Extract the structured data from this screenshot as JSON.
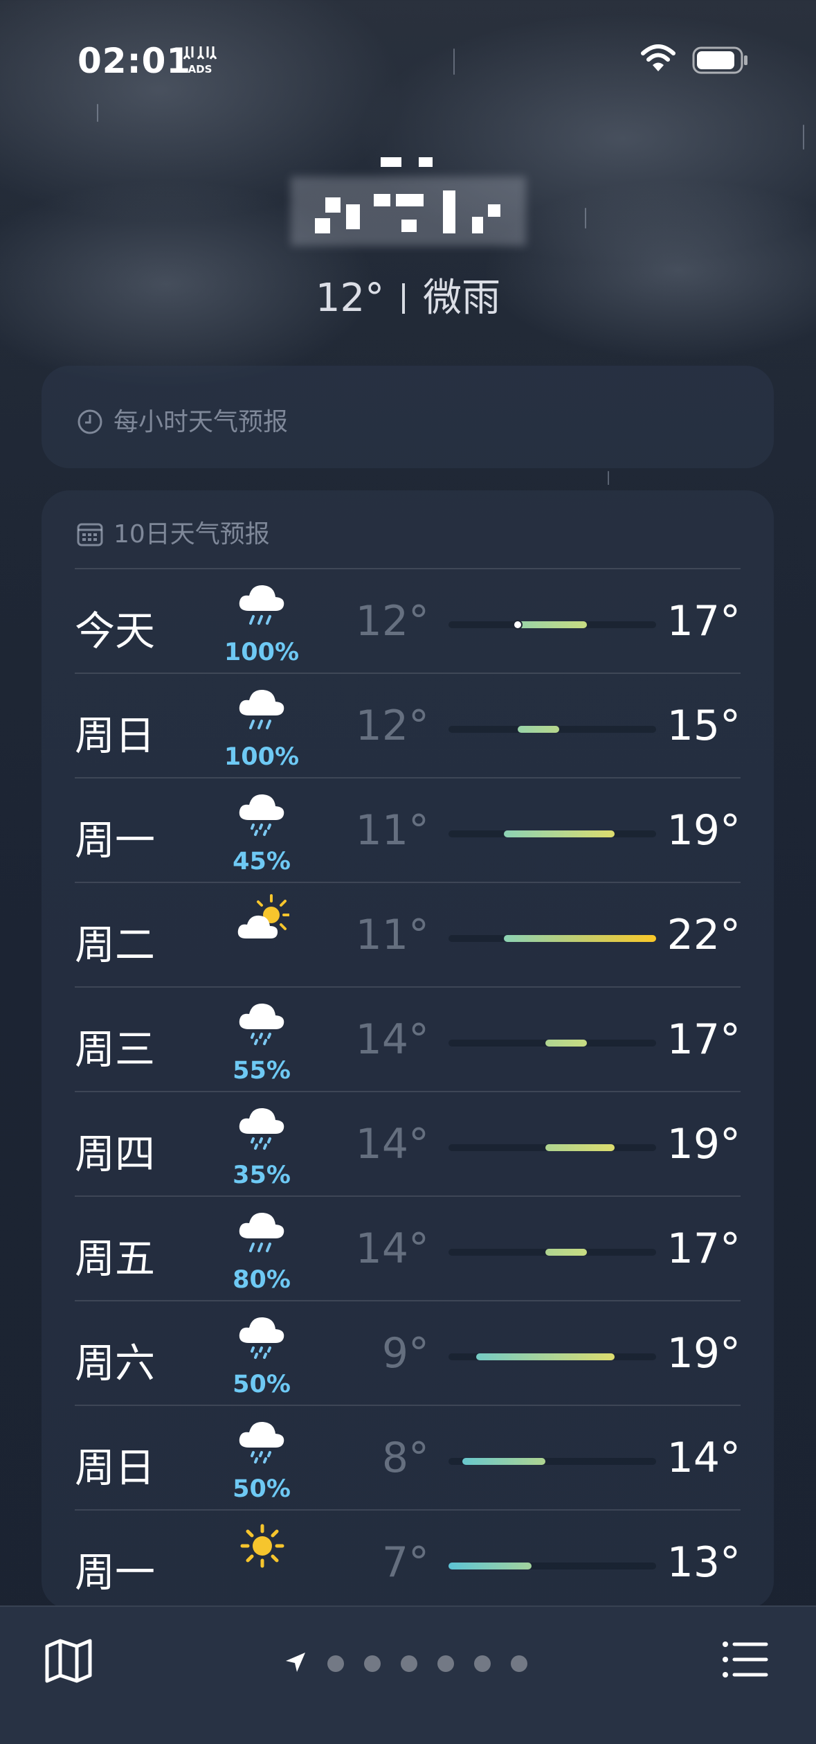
{
  "status_bar": {
    "time": "02:01",
    "ads_icon": "ads-icon",
    "wifi_icon": "wifi-icon",
    "battery_icon": "battery-icon"
  },
  "header": {
    "current_temp": "12°",
    "condition": "微雨"
  },
  "hourly_card": {
    "icon": "clock-icon",
    "title": "每小时天气预报"
  },
  "forecast_card": {
    "icon": "calendar-icon",
    "title": "10日天气预报",
    "range_scale": [
      7,
      22
    ],
    "days": [
      {
        "day": "今天",
        "icon": "rain-cloud-icon",
        "precip": "100%",
        "low": "12°",
        "high": "17°",
        "low_val": 12,
        "high_val": 17,
        "current_val": 12
      },
      {
        "day": "周日",
        "icon": "rain-cloud-icon",
        "precip": "100%",
        "low": "12°",
        "high": "15°",
        "low_val": 12,
        "high_val": 15
      },
      {
        "day": "周一",
        "icon": "light-rain-cloud-icon",
        "precip": "45%",
        "low": "11°",
        "high": "19°",
        "low_val": 11,
        "high_val": 19
      },
      {
        "day": "周二",
        "icon": "partly-sunny-icon",
        "precip": "",
        "low": "11°",
        "high": "22°",
        "low_val": 11,
        "high_val": 22
      },
      {
        "day": "周三",
        "icon": "light-rain-cloud-icon",
        "precip": "55%",
        "low": "14°",
        "high": "17°",
        "low_val": 14,
        "high_val": 17
      },
      {
        "day": "周四",
        "icon": "light-rain-cloud-icon",
        "precip": "35%",
        "low": "14°",
        "high": "19°",
        "low_val": 14,
        "high_val": 19
      },
      {
        "day": "周五",
        "icon": "rain-cloud-icon",
        "precip": "80%",
        "low": "14°",
        "high": "17°",
        "low_val": 14,
        "high_val": 17
      },
      {
        "day": "周六",
        "icon": "light-rain-cloud-icon",
        "precip": "50%",
        "low": "9°",
        "high": "19°",
        "low_val": 9,
        "high_val": 19
      },
      {
        "day": "周日",
        "icon": "light-rain-cloud-icon",
        "precip": "50%",
        "low": "8°",
        "high": "14°",
        "low_val": 8,
        "high_val": 14
      },
      {
        "day": "周一",
        "icon": "sun-icon",
        "precip": "",
        "low": "7°",
        "high": "13°",
        "low_val": 7,
        "high_val": 13
      }
    ]
  },
  "bottom_bar": {
    "map_icon": "map-icon",
    "location_icon": "location-arrow-icon",
    "page_count": 6,
    "list_icon": "list-icon"
  }
}
